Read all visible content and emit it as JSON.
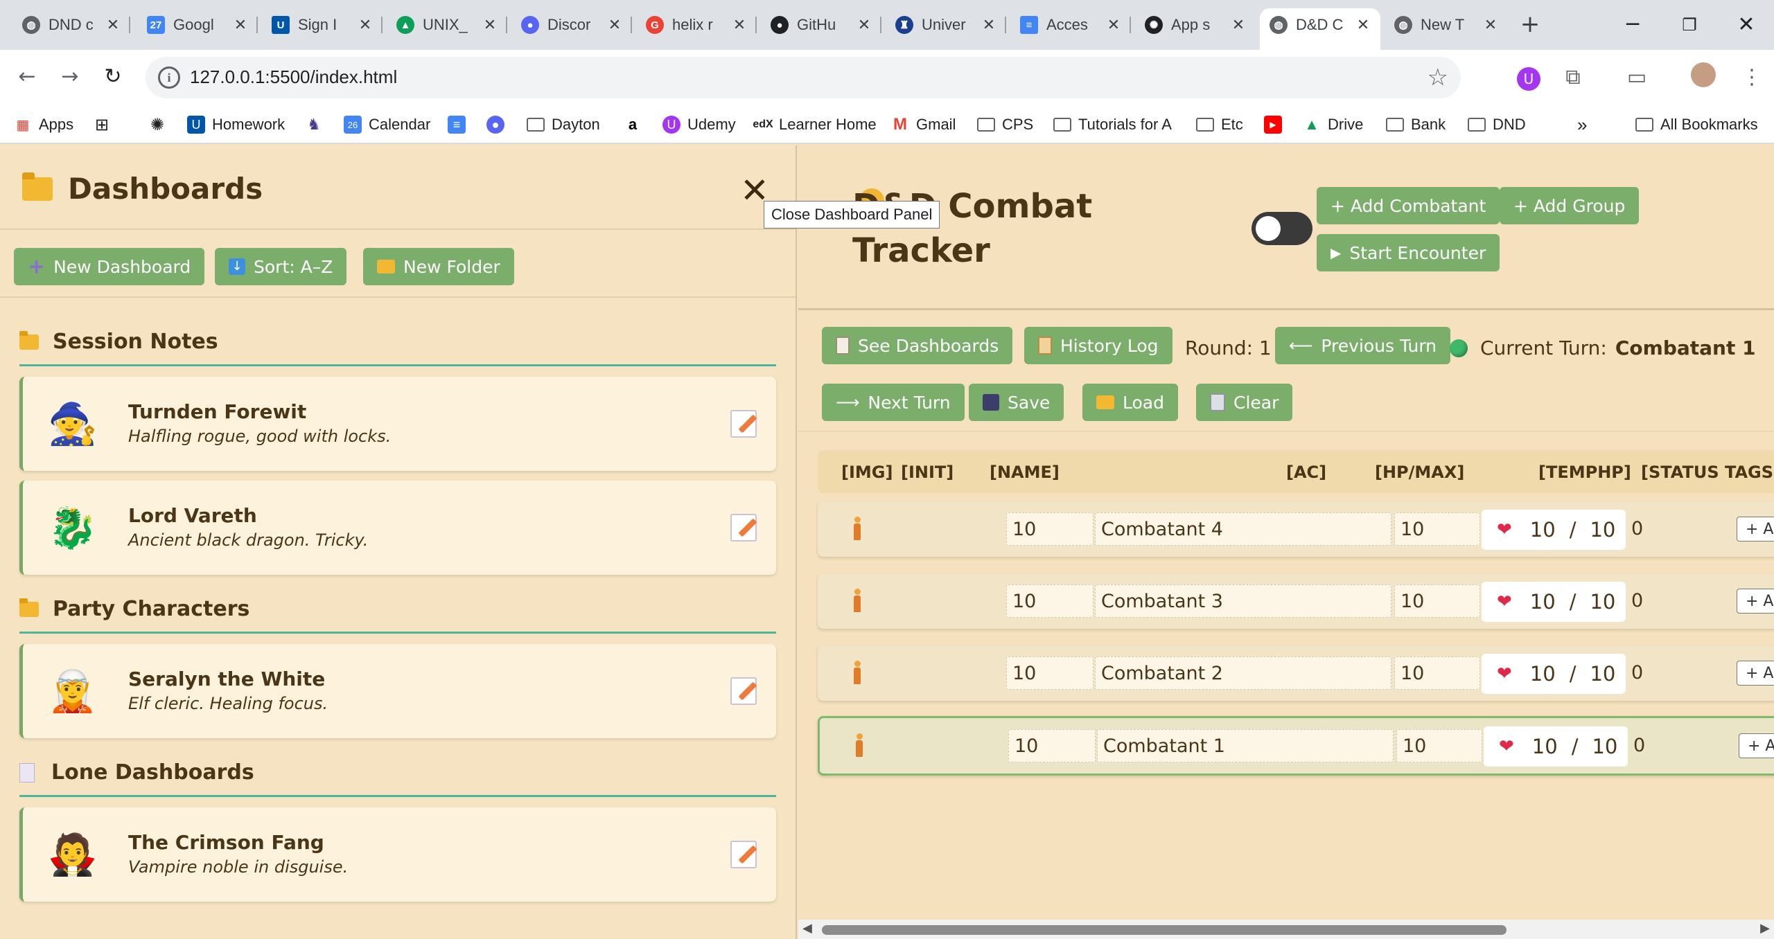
{
  "browser": {
    "tabs": [
      {
        "label": "DND c",
        "color": "#5f6368"
      },
      {
        "label": "Googl",
        "color": "#4285f4"
      },
      {
        "label": "Sign I",
        "color": "#0056a8"
      },
      {
        "label": "UNIX_",
        "color": "#0f9d58"
      },
      {
        "label": "Discor",
        "color": "#5865f2"
      },
      {
        "label": "helix r",
        "color": "#ea4335"
      },
      {
        "label": "GitHu",
        "color": "#202124"
      },
      {
        "label": "Univer",
        "color": "#1a3f8f"
      },
      {
        "label": "Acces",
        "color": "#4285f4"
      },
      {
        "label": "App s",
        "color": "#202124"
      },
      {
        "label": "D&D C",
        "color": "#5f6368"
      },
      {
        "label": "New T",
        "color": "#5f6368"
      }
    ],
    "url": "127.0.0.1:5500/index.html",
    "bookmarks": [
      {
        "label": "Apps",
        "type": "grid"
      },
      {
        "label": "",
        "type": "grid"
      },
      {
        "label": "",
        "type": "icon"
      },
      {
        "label": "Homework",
        "type": "icon"
      },
      {
        "label": "",
        "type": "icon"
      },
      {
        "label": "Calendar",
        "type": "icon"
      },
      {
        "label": "",
        "type": "icon"
      },
      {
        "label": "",
        "type": "icon"
      },
      {
        "label": "Dayton",
        "type": "folder"
      },
      {
        "label": "",
        "type": "icon"
      },
      {
        "label": "Udemy",
        "type": "icon"
      },
      {
        "label": "Learner Home",
        "type": "icon"
      },
      {
        "label": "Gmail",
        "type": "icon"
      },
      {
        "label": "CPS",
        "type": "folder"
      },
      {
        "label": "Tutorials for A",
        "type": "folder"
      },
      {
        "label": "Etc",
        "type": "folder"
      },
      {
        "label": "",
        "type": "icon"
      },
      {
        "label": "Drive",
        "type": "icon"
      },
      {
        "label": "Bank",
        "type": "folder"
      },
      {
        "label": "DND",
        "type": "folder"
      },
      {
        "label": "All Bookmarks",
        "type": "folder"
      }
    ]
  },
  "panel": {
    "title": "Dashboards",
    "close_tooltip": "Close Dashboard Panel",
    "actions": {
      "new_dashboard": "New Dashboard",
      "sort": "Sort: A–Z",
      "new_folder": "New Folder"
    },
    "sections": [
      {
        "title": "Session Notes",
        "cards": [
          {
            "name": "Turnden Forewit",
            "desc": "Halfling rogue, good with locks.",
            "avatar": "🧙"
          },
          {
            "name": "Lord Vareth",
            "desc": "Ancient black dragon. Tricky.",
            "avatar": "🐉"
          }
        ]
      },
      {
        "title": "Party Characters",
        "cards": [
          {
            "name": "Seralyn the White",
            "desc": "Elf cleric. Healing focus.",
            "avatar": "🧝"
          }
        ]
      },
      {
        "title": "Lone Dashboards",
        "cards": [
          {
            "name": "The Crimson Fang",
            "desc": "Vampire noble in disguise.",
            "avatar": "🧛"
          }
        ]
      }
    ]
  },
  "tracker": {
    "title": "D&D Combat Tracker",
    "buttons": {
      "add_combatant": "+ Add Combatant",
      "add_group": "+ Add Group",
      "start_encounter": "Start Encounter",
      "see_dashboards": "See Dashboards",
      "history_log": "History Log",
      "previous_turn": "Previous Turn",
      "next_turn": "Next Turn",
      "save": "Save",
      "load": "Load",
      "clear": "Clear"
    },
    "round_label": "Round: 1",
    "current_turn_label": "Current Turn:",
    "current_turn_name": "Combatant 1",
    "columns": [
      "[IMG]",
      "[INIT]",
      "[NAME]",
      "[AC]",
      "[HP/MAX]",
      "[TEMPHP]",
      "[STATUS TAGS]"
    ],
    "rows": [
      {
        "init": "10",
        "name": "Combatant 4",
        "ac": "10",
        "hp": "10",
        "max": "10",
        "temphp": "0",
        "status": "+ Add"
      },
      {
        "init": "10",
        "name": "Combatant 3",
        "ac": "10",
        "hp": "10",
        "max": "10",
        "temphp": "0",
        "status": "+ Add"
      },
      {
        "init": "10",
        "name": "Combatant 2",
        "ac": "10",
        "hp": "10",
        "max": "10",
        "temphp": "0",
        "status": "+ Add"
      },
      {
        "init": "10",
        "name": "Combatant 1",
        "ac": "10",
        "hp": "10",
        "max": "10",
        "temphp": "0",
        "status": "+ Add"
      }
    ]
  }
}
